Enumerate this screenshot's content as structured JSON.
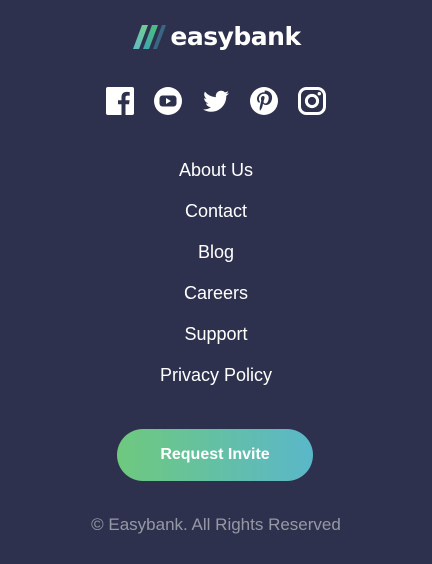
{
  "brand": {
    "name": "easybank",
    "colors": {
      "background": "#2d314d",
      "gradient_start": "#33d35e",
      "gradient_end": "#2ab6d9",
      "muted_text": "#9698a6"
    }
  },
  "social": [
    {
      "icon": "facebook-icon"
    },
    {
      "icon": "youtube-icon"
    },
    {
      "icon": "twitter-icon"
    },
    {
      "icon": "pinterest-icon"
    },
    {
      "icon": "instagram-icon"
    }
  ],
  "nav": {
    "items": [
      {
        "label": "About Us"
      },
      {
        "label": "Contact"
      },
      {
        "label": "Blog"
      },
      {
        "label": "Careers"
      },
      {
        "label": "Support"
      },
      {
        "label": "Privacy Policy"
      }
    ]
  },
  "cta": {
    "label": "Request Invite"
  },
  "footer": {
    "copyright": "© Easybank. All Rights Reserved"
  }
}
